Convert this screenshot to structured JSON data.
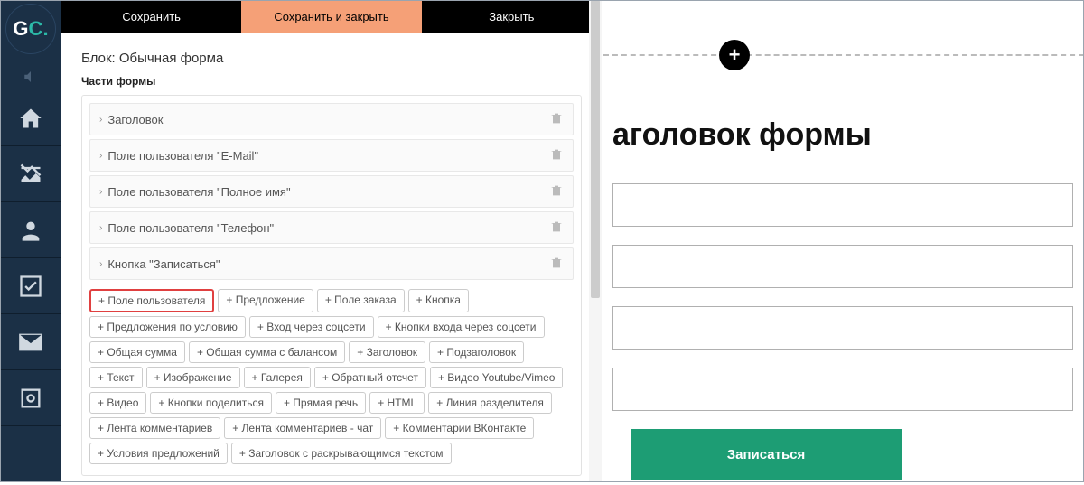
{
  "logo": {
    "g": "G",
    "c": "C",
    "dot": "."
  },
  "toolbar": {
    "save": "Сохранить",
    "save_close": "Сохранить и закрыть",
    "close": "Закрыть"
  },
  "block_title": "Блок: Обычная форма",
  "section_title": "Части формы",
  "parts": [
    {
      "label": "Заголовок"
    },
    {
      "label": "Поле пользователя \"E-Mail\""
    },
    {
      "label": "Поле пользователя \"Полное имя\""
    },
    {
      "label": "Поле пользователя \"Телефон\""
    },
    {
      "label": "Кнопка \"Записаться\""
    }
  ],
  "add_buttons": [
    {
      "label": "+ Поле пользователя",
      "highlighted": true
    },
    {
      "label": "+ Предложение"
    },
    {
      "label": "+ Поле заказа"
    },
    {
      "label": "+ Кнопка"
    },
    {
      "label": "+ Предложения по условию"
    },
    {
      "label": "+ Вход через соцсети"
    },
    {
      "label": "+ Кнопки входа через соцсети"
    },
    {
      "label": "+ Общая сумма"
    },
    {
      "label": "+ Общая сумма с балансом"
    },
    {
      "label": "+ Заголовок"
    },
    {
      "label": "+ Подзаголовок"
    },
    {
      "label": "+ Текст"
    },
    {
      "label": "+ Изображение"
    },
    {
      "label": "+ Галерея"
    },
    {
      "label": "+ Обратный отсчет"
    },
    {
      "label": "+ Видео Youtube/Vimeo"
    },
    {
      "label": "+ Видео"
    },
    {
      "label": "+ Кнопки поделиться"
    },
    {
      "label": "+ Прямая речь"
    },
    {
      "label": "+ HTML"
    },
    {
      "label": "+ Линия разделителя"
    },
    {
      "label": "+ Лента комментариев"
    },
    {
      "label": "+ Лента комментариев - чат"
    },
    {
      "label": "+ Комментарии ВКонтакте"
    },
    {
      "label": "+ Условия предложений"
    },
    {
      "label": "+ Заголовок с раскрывающимся текстом"
    }
  ],
  "preview": {
    "title": "аголовок формы",
    "submit": "Записаться"
  }
}
